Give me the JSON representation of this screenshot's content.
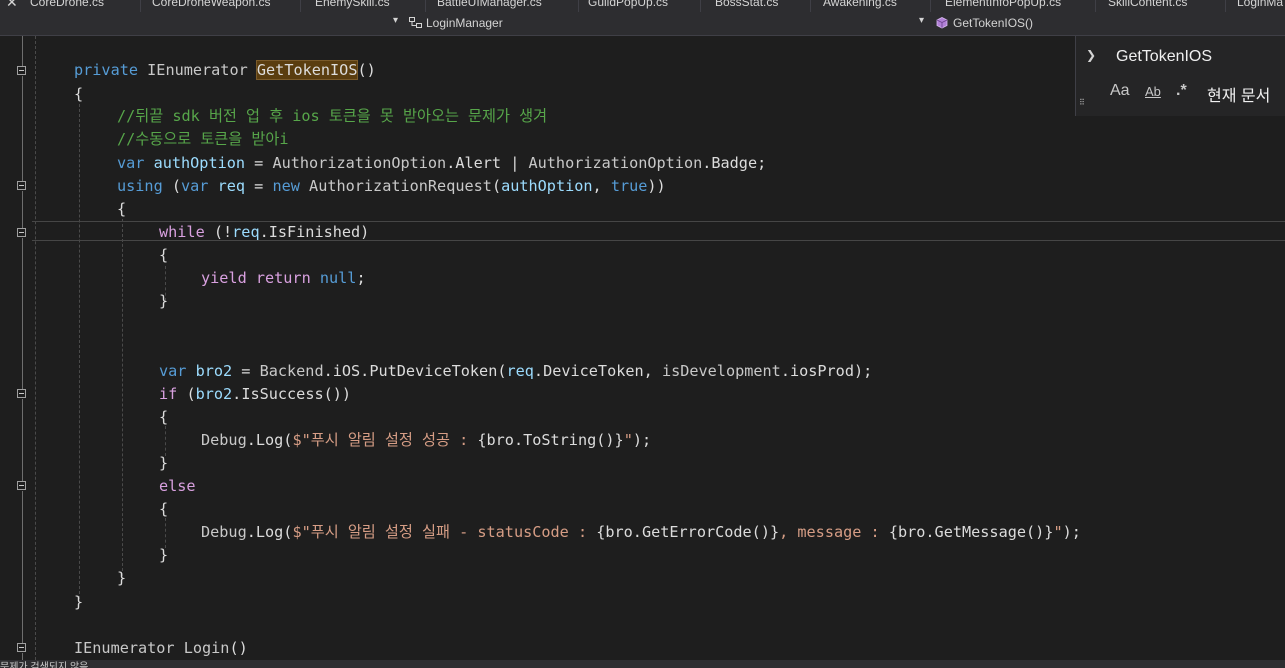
{
  "tabs": [
    "CoreDrone.cs",
    "CoreDroneWeapon.cs",
    "EnemySkill.cs",
    "BattleUIManager.cs",
    "GuildPopUp.cs",
    "BossStat.cs",
    "Awakening.cs",
    "ElementInfoPopUp.cs",
    "SkillContent.cs",
    "LoginMa"
  ],
  "navbar": {
    "class_name": "LoginManager",
    "member_name": "GetTokenIOS()"
  },
  "find": {
    "query": "GetTokenIOS",
    "match_case": "Aa",
    "match_word": "Ab",
    "regex": ".*",
    "scope": "현재 문서"
  },
  "code": {
    "l1_kw": "private",
    "l1_type": " IEnumerator ",
    "l1_name": "GetTokenIOS",
    "l1_tail": "()",
    "l2": "{",
    "c1": "//뒤끝 sdk 버전 업 후 ios 토큰을 못 받아오는 문제가 생겨",
    "c2": "//수동으로 토큰을 받아i",
    "l5_kw": "var",
    "l5_var": " authOption",
    "l5_eq": " = ",
    "l5_cls1": "AuthorizationOption",
    "l5_m1": ".Alert | ",
    "l5_cls2": "AuthorizationOption",
    "l5_m2": ".Badge;",
    "l6_using": "using",
    "l6_open": " (",
    "l6_var": "var",
    "l6_req": " req",
    "l6_eq": " = ",
    "l6_new": "new",
    "l6_cls": " AuthorizationRequest",
    "l6_p": "(",
    "l6_arg": "authOption",
    "l6_comma": ", ",
    "l6_true": "true",
    "l6_close": "))",
    "l7": "{",
    "l8_while": "while",
    "l8_rest1": " (!",
    "l8_req": "req",
    "l8_rest2": ".IsFinished)",
    "l9": "{",
    "l10_yield": "yield",
    "l10_return": " return",
    "l10_null": " null",
    "l10_end": ";",
    "l11": "}",
    "l14_var": "var",
    "l14_bro2": " bro2",
    "l14_eq": " = ",
    "l14_cls": "Backend",
    "l14_call": ".iOS.PutDeviceToken(",
    "l14_req": "req",
    "l14_mid": ".DeviceToken, ",
    "l14_cls2": "isDevelopment",
    "l14_end": ".iosProd);",
    "l15_if": "if",
    "l15_open": " (",
    "l15_bro2": "bro2",
    "l15_rest": ".IsSuccess())",
    "l16": "{",
    "l17_cls": "Debug",
    "l17_log": ".Log(",
    "l17_str": "$\"푸시 알림 설정 성공 : ",
    "l17_interp": "{bro.ToString()}",
    "l17_strend": "\"",
    "l17_end": ");",
    "l18": "}",
    "l19_else": "else",
    "l20": "{",
    "l21_cls": "Debug",
    "l21_log": ".Log(",
    "l21_str1": "$\"푸시 알림 설정 실패 - statusCode : ",
    "l21_i1": "{bro.GetErrorCode()}",
    "l21_str2": ", message : ",
    "l21_i2": "{bro.GetMessage()}",
    "l21_strend": "\"",
    "l21_end": ");",
    "l22": "}",
    "l23": "}",
    "l24": "}",
    "l26_type": "IEnumerator",
    "l26_name": " Login",
    "l26_tail": "()"
  },
  "status": {
    "text": "문제가 검색되지 않음"
  }
}
